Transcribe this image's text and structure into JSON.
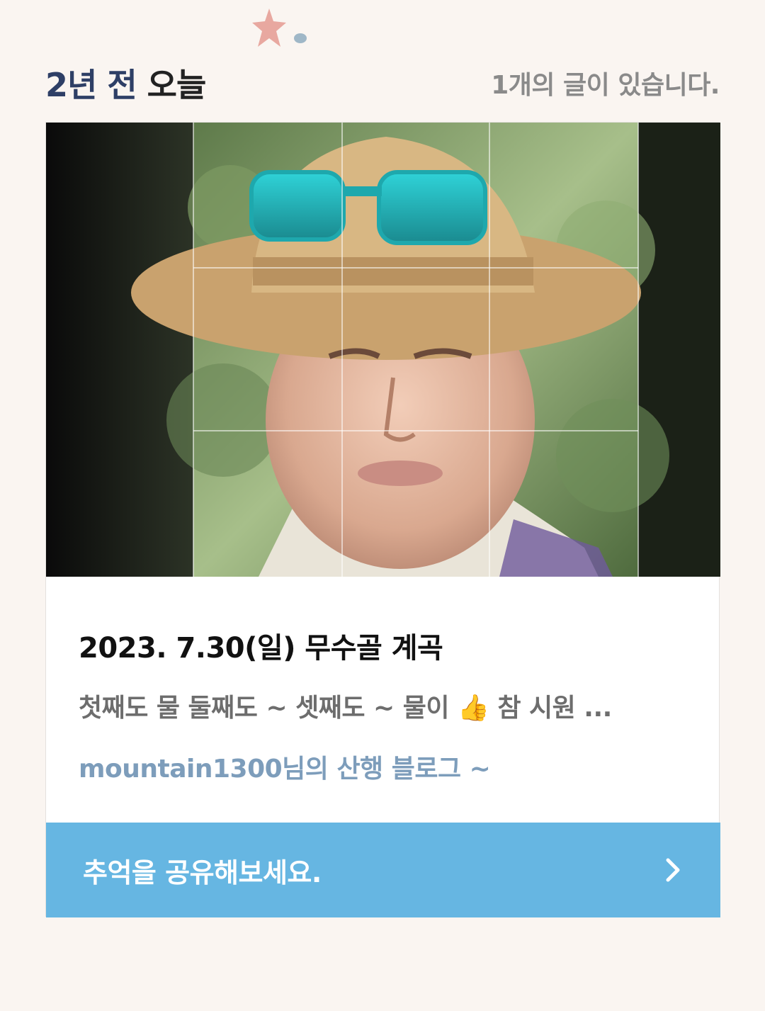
{
  "header": {
    "title_accent": "2년 전",
    "title_rest": " 오늘",
    "count_text": "1개의 글이 있습니다."
  },
  "post": {
    "title": "2023. 7.30(일) 무수골 계곡",
    "snippet": "첫째도 물 둘째도 ~ 셋째도 ~ 물이 👍 참 시원 ...",
    "blog_name": "mountain1300님의 산행 블로그 ~"
  },
  "share": {
    "label": "추억을 공유해보세요."
  },
  "colors": {
    "background": "#faf5f1",
    "title_accent": "#2e3f66",
    "share_button": "#66b6e2",
    "blog_name": "#7d9dbb"
  },
  "icons": {
    "decoration": "star-decoration-icon",
    "share_chevron": "chevron-right-icon"
  }
}
